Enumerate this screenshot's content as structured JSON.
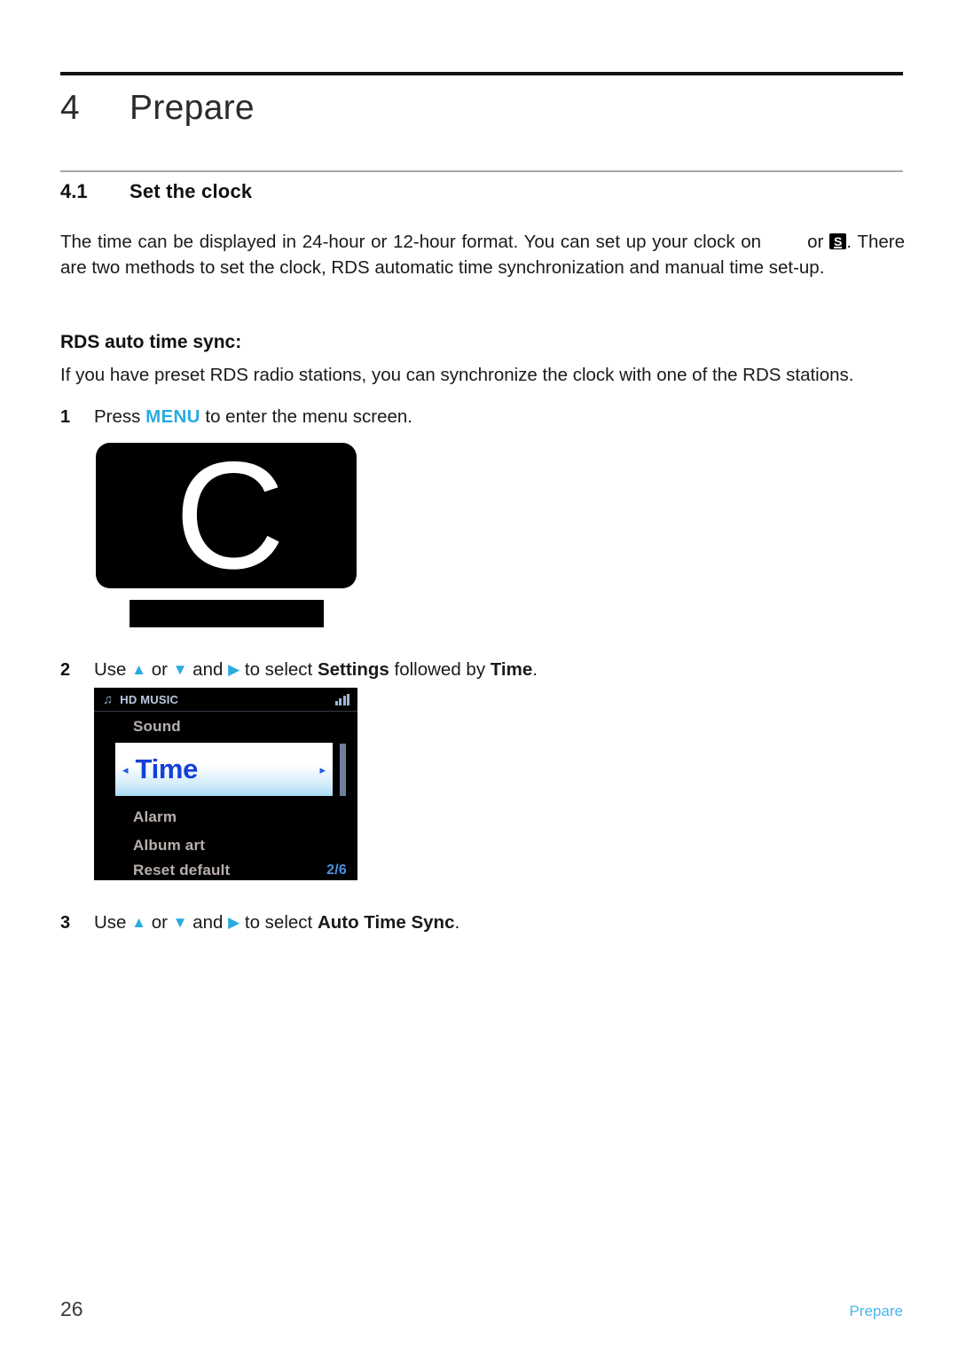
{
  "chapter": {
    "number": "4",
    "title": "Prepare"
  },
  "section": {
    "number": "4.1",
    "title": "Set the clock"
  },
  "intro": {
    "part1": "The time can be displayed in 24-hour or 12-hour format. You can set up your clock on",
    "or_label": "or",
    "badge_letter": "S",
    "part2": ". There are two methods to set the clock, RDS automatic time synchronization and manual time set-up."
  },
  "rds": {
    "heading": "RDS auto time sync:",
    "paragraph": "If you have preset RDS radio stations, you can synchronize the clock with one of the RDS stations."
  },
  "steps": [
    {
      "number": "1",
      "pre": "Press",
      "key": "MENU",
      "post": "to enter the menu screen."
    },
    {
      "number": "2",
      "use": "Use",
      "up": "▲",
      "or": "or",
      "down": "▼",
      "and": "and",
      "right": "▶",
      "select": "to select",
      "bold1": "Settings",
      "mid": "followed by",
      "bold2": "Time",
      "end": "."
    },
    {
      "number": "3",
      "use": "Use",
      "up": "▲",
      "or": "or",
      "down": "▼",
      "and": "and",
      "right": "▶",
      "select": "to select",
      "bold1": "Auto Time Sync",
      "end": "."
    }
  ],
  "figure_menu_screen": {
    "letter": "C"
  },
  "figure_lcd": {
    "source_icon": "music-note-icon",
    "source_label": "HD MUSIC",
    "signal_icon": "signal-bars-icon",
    "rows": [
      {
        "label": "Sound"
      },
      {
        "label": "Alarm"
      },
      {
        "label": "Album art"
      },
      {
        "label": "Reset default"
      }
    ],
    "selected": {
      "label": "Time",
      "left_arrow": "◂",
      "right_arrow": "▸"
    },
    "page_indicator": "2/6"
  },
  "footer": {
    "page_number": "26",
    "label": "Prepare"
  },
  "colors": {
    "accent_blue": "#29ABE2",
    "footer_blue": "#4ab4ec",
    "lcd_selected_text": "#1440d8",
    "lcd_row_text": "#b9b0ad"
  }
}
